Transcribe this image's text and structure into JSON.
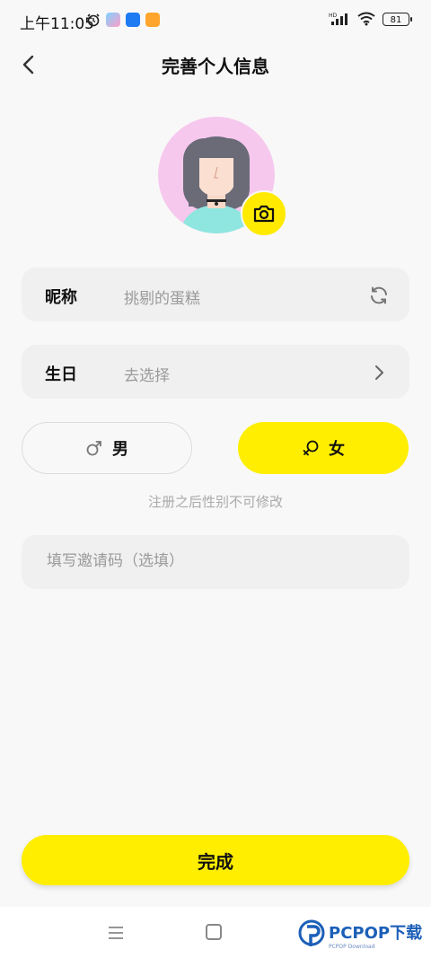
{
  "status_bar": {
    "time": "上午11:05",
    "battery": "81",
    "network": "HD"
  },
  "header": {
    "title": "完善个人信息"
  },
  "form": {
    "nickname_label": "昵称",
    "nickname_value": "挑剔的蛋糕",
    "birthday_label": "生日",
    "birthday_value": "去选择",
    "gender_male_label": "男",
    "gender_female_label": "女",
    "selected_gender": "女",
    "gender_hint": "注册之后性别不可修改",
    "invite_placeholder": "填写邀请码（选填）",
    "submit_label": "完成"
  },
  "watermark": {
    "brand": "PCPOP下载",
    "sub": "PCPOP Download"
  },
  "colors": {
    "accent": "#ffee00",
    "avatar_bg": "#f6c8ee",
    "row_bg": "#f0f0f0"
  }
}
